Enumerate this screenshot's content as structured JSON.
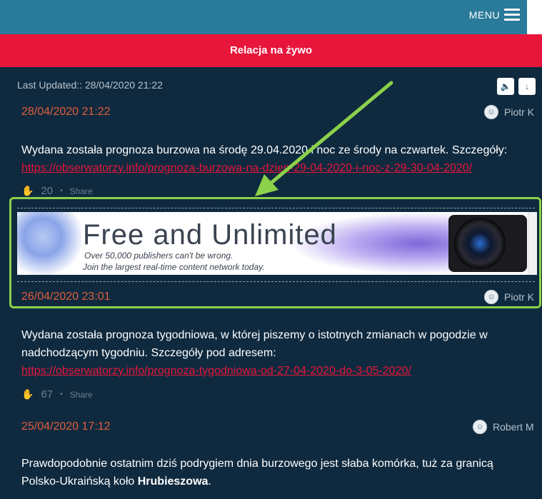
{
  "header": {
    "menu_label": "MENU"
  },
  "live": {
    "title": "Relacja na żywo"
  },
  "feed": {
    "last_updated": "Last Updated:: 28/04/2020 21:22",
    "sound_icon": "speaker-icon",
    "down_icon": "arrow-down-icon"
  },
  "posts": [
    {
      "date": "28/04/2020 21:22",
      "author": "Piotr K",
      "text": "Wydana została prognoza burzowa na środę 29.04.2020 i noc ze środy na czwartek. Szczegóły:",
      "link": "https://obserwatorzy.info/prognoza-burzowa-na-dzien-29-04-2020-i-noc-z-29-30-04-2020/",
      "claps": "20",
      "share": "Share"
    },
    {
      "date": "26/04/2020 23:01",
      "author": "Piotr K",
      "text": "Wydana została prognoza tygodniowa, w której piszemy o istotnych zmianach w pogodzie w nadchodzącym tygodniu. Szczegóły pod adresem:",
      "link": "https://obserwatorzy.info/prognoza-tygodniowa-od-27-04-2020-do-3-05-2020/",
      "claps": "67",
      "share": "Share"
    },
    {
      "date": "25/04/2020 17:12",
      "author": "Robert M",
      "text_before": "Prawdopodobnie ostatnim dziś podrygiem dnia burzowego jest słaba komórka, tuż za granicą Polsko-Ukraińską koło ",
      "text_bold": "Hrubieszowa",
      "text_after": "."
    }
  ],
  "ad": {
    "headline": "Free and Unlimited",
    "line1": "Over 50,000 publishers can't be wrong.",
    "line2": "Join the largest real-time content network today."
  },
  "colors": {
    "topbar": "#2a7a99",
    "live_bar": "#e8153b",
    "feed_bg": "#0f2a3f",
    "date": "#e25c3b",
    "link": "#e8153b",
    "highlight": "#8bd14a"
  }
}
